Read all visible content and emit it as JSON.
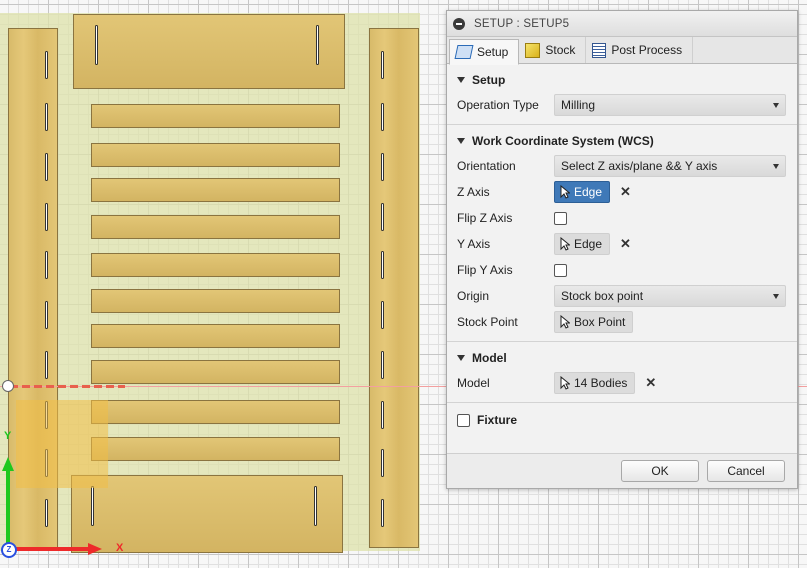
{
  "panel": {
    "title": "SETUP : SETUP5",
    "tabs": [
      {
        "label": "Setup",
        "icon": "setup-icon"
      },
      {
        "label": "Stock",
        "icon": "stock-icon"
      },
      {
        "label": "Post Process",
        "icon": "post-process-icon"
      }
    ],
    "sections": {
      "setup": {
        "header": "Setup",
        "operation_type_label": "Operation Type",
        "operation_type_value": "Milling"
      },
      "wcs": {
        "header": "Work Coordinate System (WCS)",
        "orientation_label": "Orientation",
        "orientation_value": "Select Z axis/plane && Y axis",
        "z_axis_label": "Z Axis",
        "z_axis_value": "Edge",
        "flip_z_label": "Flip Z Axis",
        "y_axis_label": "Y Axis",
        "y_axis_value": "Edge",
        "flip_y_label": "Flip Y Axis",
        "origin_label": "Origin",
        "origin_value": "Stock box point",
        "stock_point_label": "Stock Point",
        "stock_point_value": "Box Point"
      },
      "model": {
        "header": "Model",
        "model_label": "Model",
        "model_value": "14 Bodies"
      },
      "fixture": {
        "header": "Fixture"
      }
    },
    "ok_label": "OK",
    "cancel_label": "Cancel"
  },
  "viewport": {
    "axis_x_label": "X",
    "axis_y_label": "Y",
    "axis_z_label": "Z"
  },
  "colors": {
    "accent_selection": "#3f79b8",
    "axis_x": "#ee2a2a",
    "axis_y": "#1ec81e",
    "axis_z": "#2a50e0"
  }
}
